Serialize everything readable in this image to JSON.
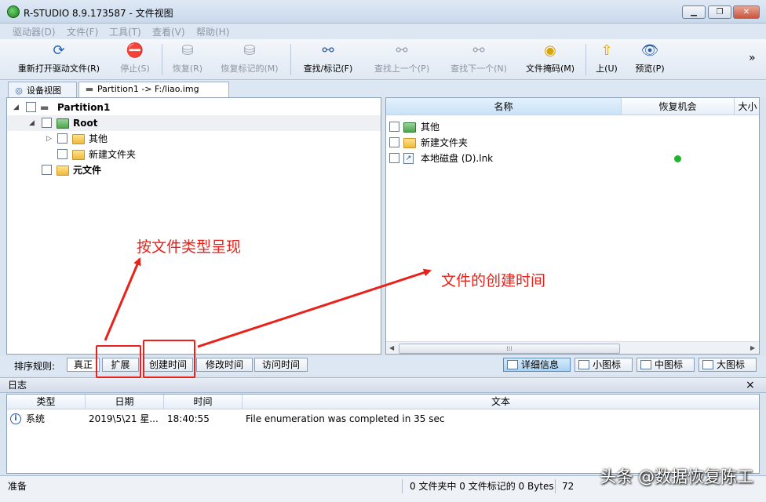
{
  "window": {
    "title": "R-STUDIO 8.9.173587 - 文件视图"
  },
  "menu": [
    "驱动器(D)",
    "文件(F)",
    "工具(T)",
    "查看(V)",
    "帮助(H)"
  ],
  "toolbar": {
    "reopen": "重新打开驱动文件(R)",
    "stop": "停止(S)",
    "recover": "恢复(R)",
    "recover_marked": "恢复标记的(M)",
    "find_mark": "查找/标记(F)",
    "find_prev": "查找上一个(P)",
    "find_next": "查找下一个(N)",
    "file_mask": "文件掩码(M)",
    "up": "上(U)",
    "preview": "预览(P)",
    "overflow": "»"
  },
  "tabs": [
    "设备视图",
    "Partition1 -> F:/liao.img"
  ],
  "tree": {
    "partition": "Partition1",
    "root": "Root",
    "child_other": "其他",
    "child_new_folder": "新建文件夹",
    "meta_files": "元文件"
  },
  "file_list": {
    "columns": [
      "名称",
      "恢复机会",
      "大小"
    ],
    "rows": [
      {
        "name": "其他",
        "type": "folder-green"
      },
      {
        "name": "新建文件夹",
        "type": "folder"
      },
      {
        "name": "本地磁盘 (D).lnk",
        "type": "shortcut",
        "chance_color": "#1bb52e"
      }
    ]
  },
  "sort": {
    "label": "排序规则:",
    "options": [
      "真正",
      "扩展",
      "创建时间",
      "修改时间",
      "访问时间"
    ]
  },
  "views": [
    "详细信息",
    "小图标",
    "中图标",
    "大图标"
  ],
  "log": {
    "title": "日志",
    "close": "×",
    "columns": [
      "类型",
      "日期",
      "时间",
      "文本"
    ],
    "rows": [
      {
        "type": "系统",
        "date": "2019\\5\\21 星...",
        "time": "18:40:55",
        "text": "File enumeration was completed in 35 sec"
      }
    ]
  },
  "status": {
    "ready": "准备",
    "summary": "0 文件夹中 0 文件标记的 0 Bytes",
    "extra": "72"
  },
  "annotations": {
    "by_type": "按文件类型呈现",
    "creation_time": "文件的创建时间",
    "color": "#e8221b"
  },
  "watermark": "头条 @数据恢复陈工"
}
